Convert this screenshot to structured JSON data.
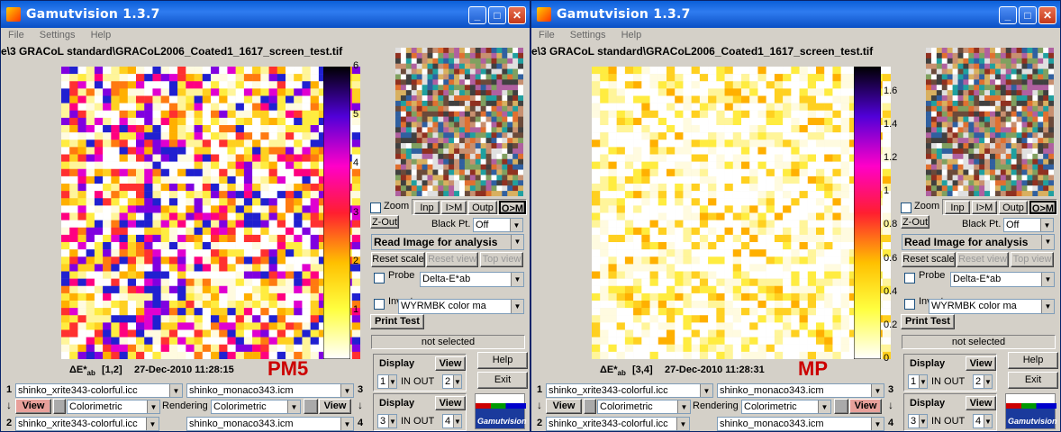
{
  "windows": [
    {
      "title": "Gamutvision 1.3.7",
      "menu": [
        "File",
        "Settings",
        "Help"
      ],
      "filepath": "e\\3 GRACoL standard\\GRACoL2006_Coated1_1617_screen_test.tif",
      "colorbar": {
        "max": 6,
        "ticks": [
          "6",
          "5",
          "4",
          "3",
          "2",
          "1"
        ]
      },
      "label_big": "PM5",
      "delta_label": "ΔE*",
      "delta_sub": "ab",
      "index": "[1,2]",
      "timestamp": "27-Dec-2010 11:28:15",
      "view_tabs": [
        "Inp",
        "I>M",
        "Outp",
        "O>M"
      ],
      "zoom": "Zoom",
      "zout": "Z-Out",
      "blackpt": "Black Pt.",
      "blackpt_val": "Off",
      "mode": "Read Image for analysis",
      "reset_scale": "Reset scale",
      "reset_view": "Reset view",
      "top_view": "Top view",
      "probe": "Probe",
      "probe_val": "Delta-E*ab",
      "invert": "Invert",
      "colormap": "WYRMBK color ma",
      "print_test": "Print Test",
      "status": "not selected",
      "display1": {
        "label": "Display",
        "view": "View",
        "in": "1",
        "inout": "IN  OUT",
        "out": "2"
      },
      "display2": {
        "label": "Display",
        "view": "View",
        "in": "3",
        "inout": "IN  OUT",
        "out": "4"
      },
      "help": "Help",
      "exit": "Exit",
      "row1": {
        "num": "1",
        "a": "shinko_xrite343-colorful.icc",
        "b": "shinko_monaco343.icm",
        "num2": "3"
      },
      "row2": {
        "view": "View",
        "intent1": "Colorimetric",
        "rendering": "Rendering",
        "intent2": "Colorimetric",
        "view2": "View"
      },
      "row3": {
        "num": "2",
        "a": "shinko_xrite343-colorful.icc",
        "b": "shinko_monaco343.icm",
        "num2": "4"
      },
      "logo": "Gamutvision"
    },
    {
      "title": "Gamutvision 1.3.7",
      "menu": [
        "File",
        "Settings",
        "Help"
      ],
      "filepath": "e\\3 GRACoL standard\\GRACoL2006_Coated1_1617_screen_test.tif",
      "colorbar": {
        "max": 1.75,
        "ticks": [
          "1.6",
          "1.4",
          "1.2",
          "1",
          "0.8",
          "0.6",
          "0.4",
          "0.2",
          "0"
        ]
      },
      "label_big": "MP",
      "delta_label": "ΔE*",
      "delta_sub": "ab",
      "index": "[3,4]",
      "timestamp": "27-Dec-2010 11:28:31",
      "view_tabs": [
        "Inp",
        "I>M",
        "Outp",
        "O>M"
      ],
      "zoom": "Zoom",
      "zout": "Z-Out",
      "blackpt": "Black Pt.",
      "blackpt_val": "Off",
      "mode": "Read Image for analysis",
      "reset_scale": "Reset scale",
      "reset_view": "Reset view",
      "top_view": "Top view",
      "probe": "Probe",
      "probe_val": "Delta-E*ab",
      "invert": "Invert",
      "colormap": "WYRMBK color ma",
      "print_test": "Print Test",
      "status": "not selected",
      "display1": {
        "label": "Display",
        "view": "View",
        "in": "1",
        "inout": "IN  OUT",
        "out": "2"
      },
      "display2": {
        "label": "Display",
        "view": "View",
        "in": "3",
        "inout": "IN  OUT",
        "out": "4"
      },
      "help": "Help",
      "exit": "Exit",
      "row1": {
        "num": "1",
        "a": "shinko_xrite343-colorful.icc",
        "b": "shinko_monaco343.icm",
        "num2": "3"
      },
      "row2": {
        "view": "View",
        "intent1": "Colorimetric",
        "rendering": "Rendering",
        "intent2": "Colorimetric",
        "view2": "View"
      },
      "row3": {
        "num": "2",
        "a": "shinko_xrite343-colorful.icc",
        "b": "shinko_monaco343.icm",
        "num2": "4"
      },
      "logo": "Gamutvision"
    }
  ],
  "colors": {
    "titlebar": "#0a5fd8",
    "accent_red": "#cc0000"
  }
}
